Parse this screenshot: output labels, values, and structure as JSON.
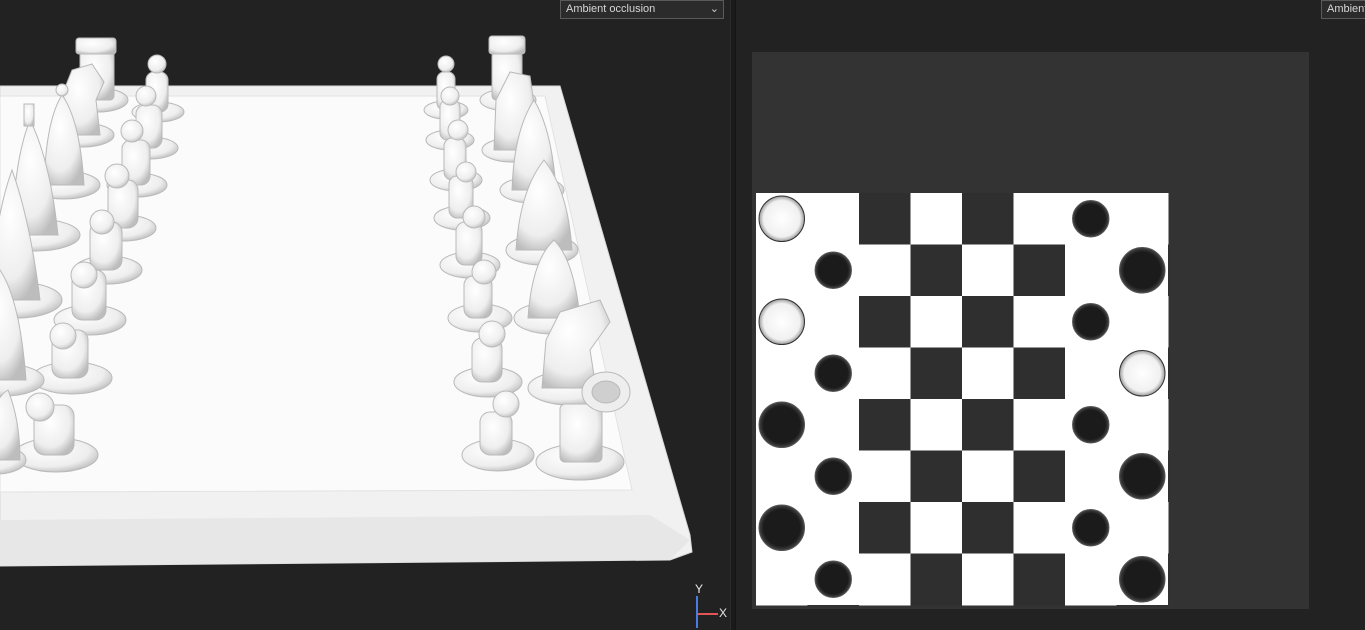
{
  "viewports": {
    "left": {
      "mode": "Ambient occlusion"
    },
    "right": {
      "mode": "Ambient occlusion"
    }
  },
  "axis_gizmo": {
    "y_label": "Y",
    "x_label": "X"
  },
  "colors": {
    "background": "#222222",
    "texture_canvas": "#333333",
    "dark_square": "#2f2f2f",
    "light_square": "#ffffff",
    "white_piece": "#f4f4f4",
    "black_piece": "#161616",
    "axis_y": "#4a7be0",
    "axis_x": "#e25555"
  },
  "icons": {
    "dropdown": "chevron-down-icon"
  }
}
